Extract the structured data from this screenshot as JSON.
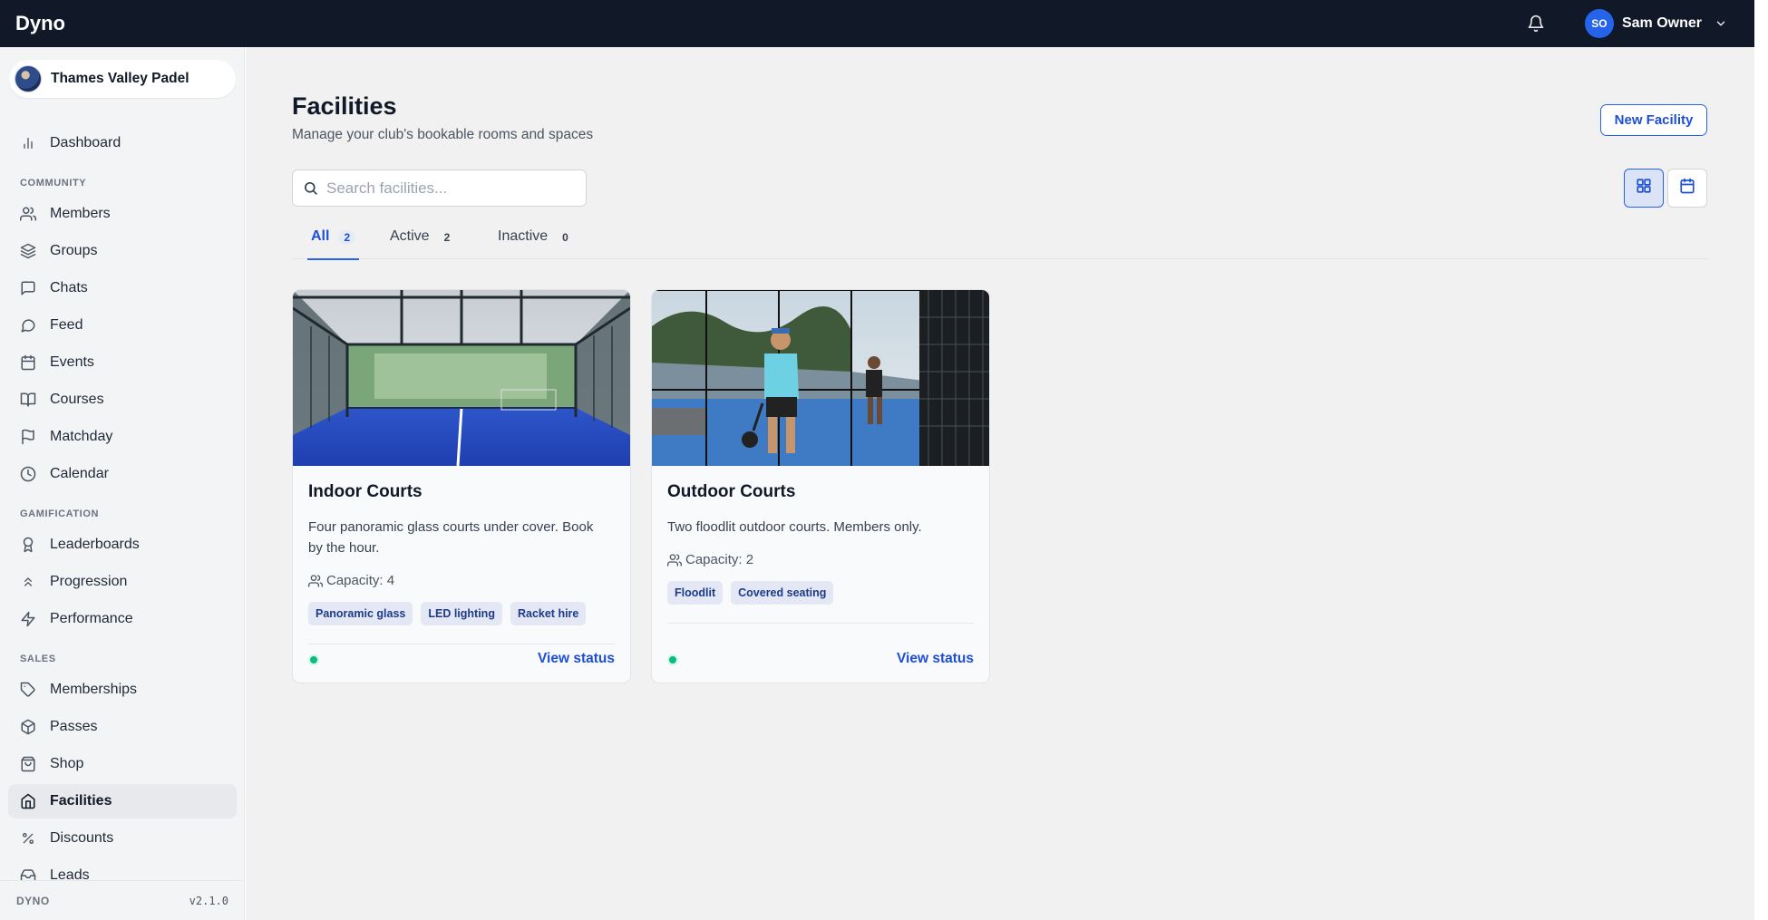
{
  "app": {
    "brand": "Dyno"
  },
  "header": {
    "user_initials": "SO",
    "user_name": "Sam Owner"
  },
  "club": {
    "name": "Thames Valley Padel"
  },
  "sidebar": {
    "top_item": {
      "label": "Dashboard",
      "icon": "bar-chart-icon"
    },
    "sections": [
      {
        "title": "COMMUNITY",
        "items": [
          {
            "label": "Members",
            "icon": "users-icon"
          },
          {
            "label": "Groups",
            "icon": "layers-icon"
          },
          {
            "label": "Chats",
            "icon": "message-square-icon"
          },
          {
            "label": "Feed",
            "icon": "message-circle-icon"
          },
          {
            "label": "Events",
            "icon": "calendar-icon"
          },
          {
            "label": "Courses",
            "icon": "book-open-icon"
          },
          {
            "label": "Matchday",
            "icon": "flag-icon"
          },
          {
            "label": "Calendar",
            "icon": "clock-icon"
          }
        ]
      },
      {
        "title": "GAMIFICATION",
        "items": [
          {
            "label": "Leaderboards",
            "icon": "award-icon"
          },
          {
            "label": "Progression",
            "icon": "chevrons-up-icon"
          },
          {
            "label": "Performance",
            "icon": "zap-icon"
          }
        ]
      },
      {
        "title": "SALES",
        "items": [
          {
            "label": "Memberships",
            "icon": "tag-icon"
          },
          {
            "label": "Passes",
            "icon": "box-icon"
          },
          {
            "label": "Shop",
            "icon": "shopping-bag-icon"
          },
          {
            "label": "Facilities",
            "icon": "home-icon",
            "active": true
          },
          {
            "label": "Discounts",
            "icon": "percent-icon"
          },
          {
            "label": "Leads",
            "icon": "inbox-icon"
          }
        ]
      }
    ],
    "footer": {
      "brand": "DYNO",
      "version": "v2.1.0"
    }
  },
  "page": {
    "title": "Facilities",
    "subtitle": "Manage your club's bookable rooms and spaces",
    "new_button": "New Facility",
    "search_placeholder": "Search facilities...",
    "tabs": [
      {
        "label": "All",
        "count": "2",
        "active": true
      },
      {
        "label": "Active",
        "count": "2"
      },
      {
        "label": "Inactive",
        "count": "0"
      }
    ]
  },
  "facilities": [
    {
      "name": "Indoor Courts",
      "description": "Four panoramic glass courts under cover. Book by the hour.",
      "capacity": "Capacity: 4",
      "tags": [
        "Panoramic glass",
        "LED lighting",
        "Racket hire"
      ],
      "status": "active",
      "action": "View status"
    },
    {
      "name": "Outdoor Courts",
      "description": "Two floodlit outdoor courts. Members only.",
      "capacity": "Capacity: 2",
      "tags": [
        "Floodlit",
        "Covered seating"
      ],
      "status": "active",
      "action": "View status"
    }
  ],
  "colors": {
    "accent": "#2563eb",
    "topbar": "#111827",
    "status_active": "#10b981"
  }
}
